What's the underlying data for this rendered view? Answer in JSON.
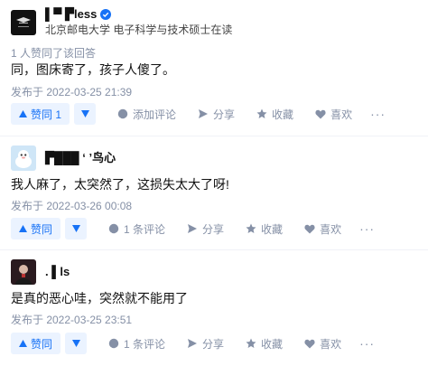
{
  "answers": [
    {
      "author": {
        "name": "▌▀ ▛less",
        "headline": "北京邮电大学 电子科学与技术硕士在读",
        "verified": true
      },
      "upvote_meta": "1 人赞同了该回答",
      "content": "同，图床寄了，孩子人傻了。",
      "date": "发布于 2022-03-25 21:39",
      "actions": {
        "upvote": "赞同 1",
        "comment": "添加评论",
        "share": "分享",
        "favorite": "收藏",
        "like": "喜欢",
        "more": "···"
      }
    },
    {
      "author": {
        "name": "▛███ ‘ ’鸟心"
      },
      "content": "我人麻了，太突然了，这损失太大了呀!",
      "date": "发布于 2022-03-26 00:08",
      "actions": {
        "upvote": "赞同",
        "comment": "1 条评论",
        "share": "分享",
        "favorite": "收藏",
        "like": "喜欢",
        "more": "···"
      }
    },
    {
      "author": {
        "name": ".   ▌ls"
      },
      "content": "是真的恶心哇，突然就不能用了",
      "date": "发布于 2022-03-25 23:51",
      "actions": {
        "upvote": "赞同",
        "comment": "1 条评论",
        "share": "分享",
        "favorite": "收藏",
        "like": "喜欢",
        "more": "···"
      }
    }
  ],
  "colors": {
    "accent": "#1772f6",
    "accent_bg": "#ebf3ff",
    "meta": "#8590a6",
    "text": "#121212",
    "verified": "#1772f6"
  }
}
